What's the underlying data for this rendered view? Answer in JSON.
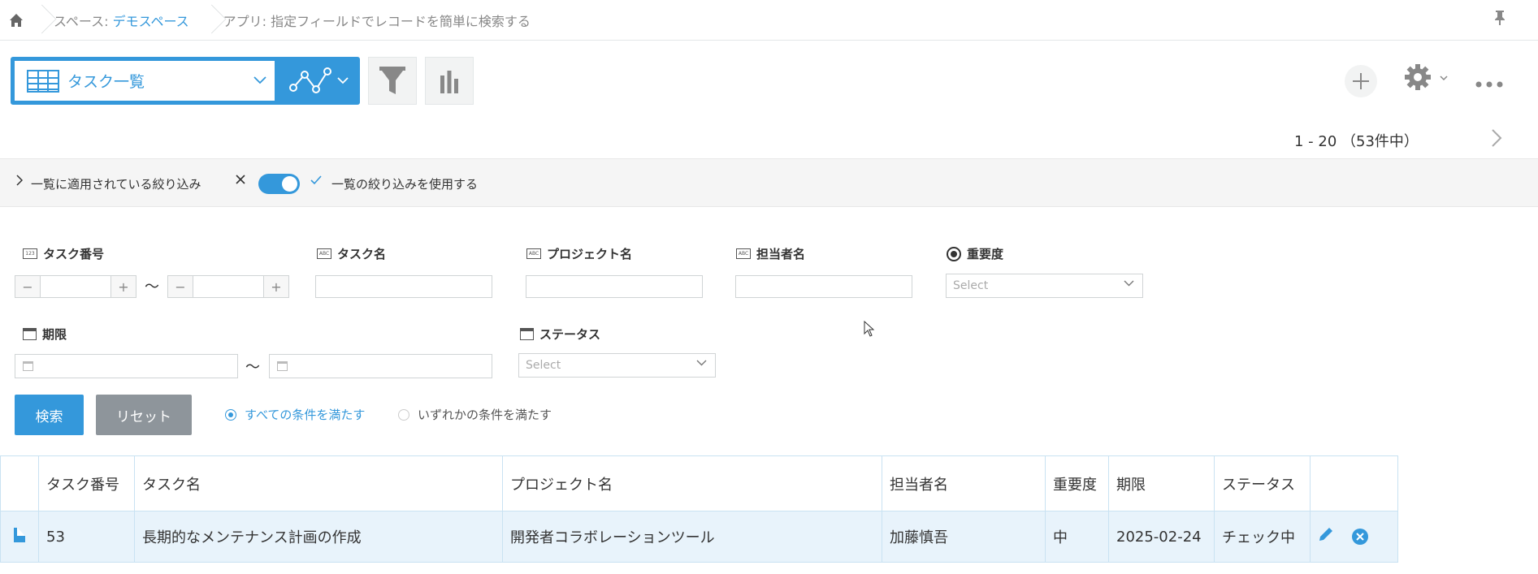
{
  "breadcrumb": {
    "space_prefix": "スペース: ",
    "space_name": "デモスペース",
    "app": "アプリ: 指定フィールドでレコードを簡単に検索する"
  },
  "toolbar": {
    "view_name": "タスク一覧"
  },
  "pager": {
    "text": "1 - 20 （53件中）"
  },
  "filter_band": {
    "applied_label": "一覧に適用されている絞り込み",
    "use_label": "一覧の絞り込みを使用する",
    "toggle_on": true
  },
  "search_form": {
    "fields": {
      "task_no": "タスク番号",
      "task_name": "タスク名",
      "project_name": "プロジェクト名",
      "assignee": "担当者名",
      "priority": "重要度",
      "due": "期限",
      "status": "ステータス"
    },
    "field_type_icons": {
      "number": "123",
      "text": "ABC"
    },
    "select_placeholder": "Select",
    "tilde": "〜",
    "search_button": "検索",
    "reset_button": "リセット",
    "match_all": "すべての条件を満たす",
    "match_any": "いずれかの条件を満たす"
  },
  "table": {
    "columns": [
      "タスク番号",
      "タスク名",
      "プロジェクト名",
      "担当者名",
      "重要度",
      "期限",
      "ステータス"
    ],
    "rows": [
      {
        "task_no": "53",
        "task_name": "長期的なメンテナンス計画の作成",
        "project": "開発者コラボレーションツール",
        "assignee": "加藤慎吾",
        "priority": "中",
        "due": "2025-02-24",
        "status": "チェック中"
      }
    ]
  },
  "colors": {
    "accent": "#3498db",
    "reset": "#8e959b",
    "row_bg": "#e8f3fb"
  }
}
